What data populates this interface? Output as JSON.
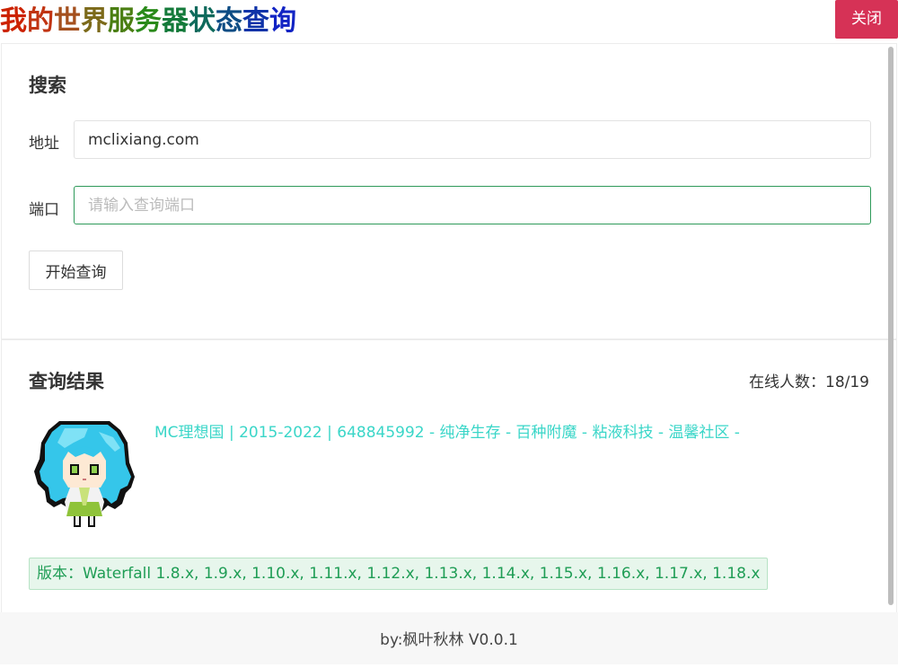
{
  "header": {
    "title_chars": [
      {
        "ch": "我",
        "color": "#cc2200"
      },
      {
        "ch": "的",
        "color": "#c13412"
      },
      {
        "ch": "世",
        "color": "#a4501e"
      },
      {
        "ch": "界",
        "color": "#7c6a1a"
      },
      {
        "ch": "服",
        "color": "#4a7e12"
      },
      {
        "ch": "务",
        "color": "#2a8a1a"
      },
      {
        "ch": "器",
        "color": "#147a3a"
      },
      {
        "ch": "状",
        "color": "#0e6a5c"
      },
      {
        "ch": "态",
        "color": "#0d4c84"
      },
      {
        "ch": "查",
        "color": "#0f33a8"
      },
      {
        "ch": "询",
        "color": "#1224c4"
      }
    ],
    "close_label": "关闭"
  },
  "search": {
    "title": "搜索",
    "address_label": "地址",
    "address_value": "mclixiang.com",
    "port_label": "端口",
    "port_placeholder": "请输入查询端口",
    "submit_label": "开始查询"
  },
  "result": {
    "title": "查询结果",
    "online_label": "在线人数：",
    "online_value": "18/19",
    "motd_segments": [
      {
        "text": "MC理想国 | 2015-2022 | 648845992 - 纯净生存 - 百种附魔 - 粘液科技 - 温馨社区 -",
        "color": "#3ad6c8"
      }
    ],
    "version_label": "版本：",
    "version_value": "Waterfall 1.8.x, 1.9.x, 1.10.x, 1.11.x, 1.12.x, 1.13.x, 1.14.x, 1.15.x, 1.16.x, 1.17.x, 1.18.x"
  },
  "footer": {
    "text": "by:枫叶秋林 V0.0.1"
  },
  "colors": {
    "close_button": "#d63256",
    "focus_border": "#2e9a5a",
    "version_text": "#1f9d55",
    "version_bg": "#e7f6ec"
  }
}
